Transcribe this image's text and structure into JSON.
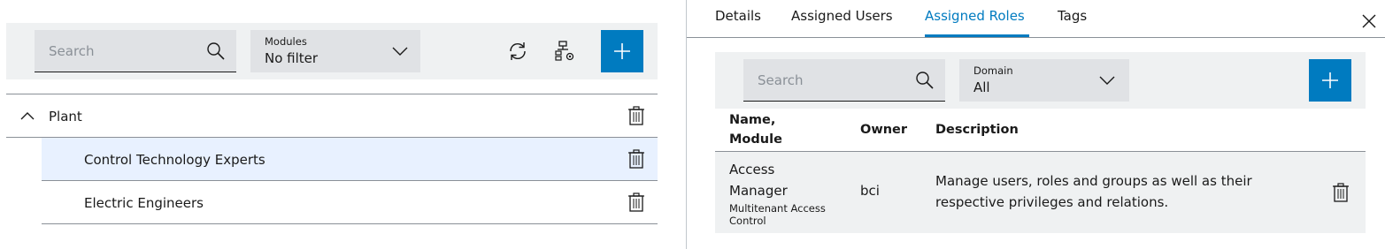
{
  "colors": {
    "accent": "#007bc0",
    "toolbar_bg": "#eff1f2",
    "field_bg": "#e0e2e5",
    "selected_row_bg": "#e8f1ff"
  },
  "left_panel": {
    "search": {
      "placeholder": "Search",
      "icon": "search-icon"
    },
    "modules_filter": {
      "label": "Modules",
      "value": "No filter",
      "icon": "chevron-down-icon"
    },
    "toolbar_icons": [
      "refresh-icon",
      "hierarchy-settings-icon"
    ],
    "add_button": {
      "icon": "plus-icon"
    },
    "tree": [
      {
        "label": "Plant",
        "level": 0,
        "expanded": true,
        "selected": false
      },
      {
        "label": "Control Technology Experts",
        "level": 1,
        "selected": true
      },
      {
        "label": "Electric Engineers",
        "level": 1,
        "selected": false
      }
    ]
  },
  "right_panel": {
    "tabs": [
      {
        "label": "Details",
        "active": false
      },
      {
        "label": "Assigned Users",
        "active": false
      },
      {
        "label": "Assigned Roles",
        "active": true
      },
      {
        "label": "Tags",
        "active": false
      }
    ],
    "close_icon": "close-icon",
    "search": {
      "placeholder": "Search",
      "icon": "search-icon"
    },
    "domain_filter": {
      "label": "Domain",
      "value": "All",
      "icon": "chevron-down-icon"
    },
    "add_button": {
      "icon": "plus-icon"
    },
    "table": {
      "columns": {
        "name_line1": "Name,",
        "name_line2": "Module",
        "owner": "Owner",
        "description": "Description"
      },
      "rows": [
        {
          "name_line1": "Access",
          "name_line2": "Manager",
          "module": "Multitenant Access Control",
          "owner": "bci",
          "description_line1": "Manage users, roles and groups as well as their",
          "description_line2": "respective privileges and relations."
        }
      ]
    }
  }
}
